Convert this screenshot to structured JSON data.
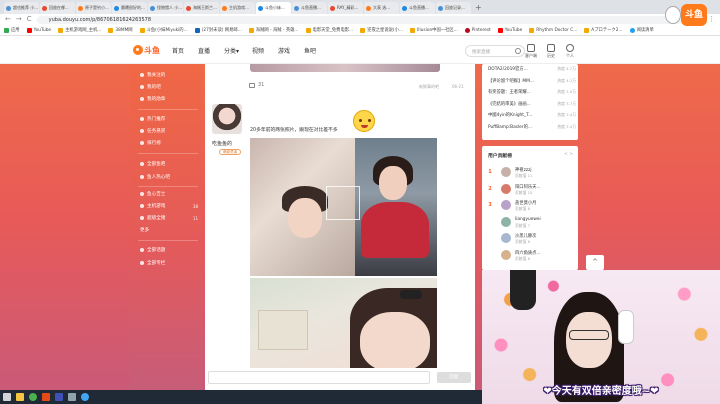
{
  "browser": {
    "tabs": [
      {
        "label": "超也推荐 小..."
      },
      {
        "label": "回放在哪..."
      },
      {
        "label": "原子是钓小..."
      },
      {
        "label": "晨曦很好的..."
      },
      {
        "label": "怪物猎人 小..."
      },
      {
        "label": "海贼王斯兰..."
      },
      {
        "label": "主机游戏..."
      },
      {
        "label": "斗鱼小妹..."
      },
      {
        "label": "斗鱼直播..."
      },
      {
        "label": "RAY_精彩..."
      },
      {
        "label": "大表 选..."
      },
      {
        "label": "斗鱼直播..."
      },
      {
        "label": "回放记录..."
      }
    ],
    "new_tab": "+",
    "url": "yuba.douyu.com/p/86706181624263578",
    "back": "←",
    "forward": "→",
    "reload": "C",
    "bookmarks": [
      {
        "label": "应用",
        "icon": "apps-icon"
      },
      {
        "label": "YouTube",
        "icon": "youtube-icon"
      },
      {
        "label": "主机游戏网_主机...",
        "icon": "folder-icon"
      },
      {
        "label": "38MM网",
        "icon": "folder-icon"
      },
      {
        "label": "斗鱼(小妹Miyuki的...",
        "icon": "folder-icon"
      },
      {
        "label": "(27封未读) 网易邮...",
        "icon": "mail-icon"
      },
      {
        "label": "海贼网 - 海贼 - 英雄...",
        "icon": "folder-icon"
      },
      {
        "label": "电影天堂_免费电影...",
        "icon": "folder-icon"
      },
      {
        "label": "逆夜之星说说(小...",
        "icon": "folder-icon"
      },
      {
        "label": "Illusion中国一社区...",
        "icon": "folder-icon"
      },
      {
        "label": "Pinterest",
        "icon": "pinterest-icon"
      },
      {
        "label": "YouTube",
        "icon": "youtube-icon"
      },
      {
        "label": "Rhythm Doctor C...",
        "icon": "folder-icon"
      },
      {
        "label": "Aプロテーク2...",
        "icon": "folder-icon"
      },
      {
        "label": "阅读清单",
        "icon": "reading-list-icon"
      }
    ]
  },
  "site": {
    "logo": "斗鱼",
    "nav": [
      "首页",
      "直播",
      "分类▾",
      "视频",
      "游戏",
      "鱼吧"
    ],
    "search_placeholder": "搜索直播",
    "header_icons": [
      {
        "label": "客户端",
        "icon": "download-icon"
      },
      {
        "label": "历史",
        "icon": "history-icon"
      },
      {
        "label": "个人",
        "icon": "user-icon"
      }
    ]
  },
  "sidebar": {
    "items": [
      {
        "label": "我关注的"
      },
      {
        "label": "我的吧"
      },
      {
        "label": "我的勋章"
      },
      {
        "label": "热门推荐"
      },
      {
        "label": "任务悬赏"
      },
      {
        "label": "排行榜"
      },
      {
        "label": "全部鱼吧"
      },
      {
        "label": "鱼人热心吧"
      },
      {
        "label": "鱼心吉士"
      },
      {
        "label": "主机游戏",
        "count": "38"
      },
      {
        "label": "超级全猪",
        "count": "11"
      },
      {
        "label": "更多"
      },
      {
        "label": "全部话题"
      },
      {
        "label": "全部专栏"
      }
    ]
  },
  "feed": {
    "prev_post": {
      "likes": "31",
      "meta": "新鲜事的吧",
      "time": "06-21"
    },
    "post": {
      "author": "吃鱼鱼的",
      "level": "萌新勇者",
      "text": "20多年前的两张照片，跟现在对比差不多"
    },
    "comment_button": "回复"
  },
  "right_list": [
    {
      "title": "DOTA2/2019官方...",
      "value": "热度 4.7万"
    },
    {
      "title": "【评论留个吧群】MM...",
      "value": "热度 4.2万"
    },
    {
      "title": "有奖答题：王者荣耀...",
      "value": "热度 3.9万"
    },
    {
      "title": "《完结的审美》画画...",
      "value": "热度 3.7万"
    },
    {
      "title": "中國4yin的Knight_T...",
      "value": "热度 3.4万"
    },
    {
      "title": "PuffBamp:Basler的...",
      "value": "热度 3.4万"
    }
  ],
  "ranking": {
    "title": "用户贡献榜",
    "more": "<  >",
    "rows": [
      {
        "rank": "1",
        "name": "神祖zzzj",
        "fans": "贡献值 11"
      },
      {
        "rank": "2",
        "name": "阳口阿乐天...",
        "fans": "贡献值 10"
      },
      {
        "rank": "3",
        "name": "盖世莫小月",
        "fans": "贡献值 8"
      },
      {
        "rank": "",
        "name": "liangyuewei",
        "fans": "贡献值 7"
      },
      {
        "rank": "",
        "name": "沙黑儿静次",
        "fans": "贡献值 6"
      },
      {
        "rank": "",
        "name": "四六角质点...",
        "fans": "贡献值 6"
      }
    ]
  },
  "to_top": "^",
  "stream": {
    "brand": "斗鱼",
    "caption": "❤今天有双倍亲密度哦~❤"
  }
}
